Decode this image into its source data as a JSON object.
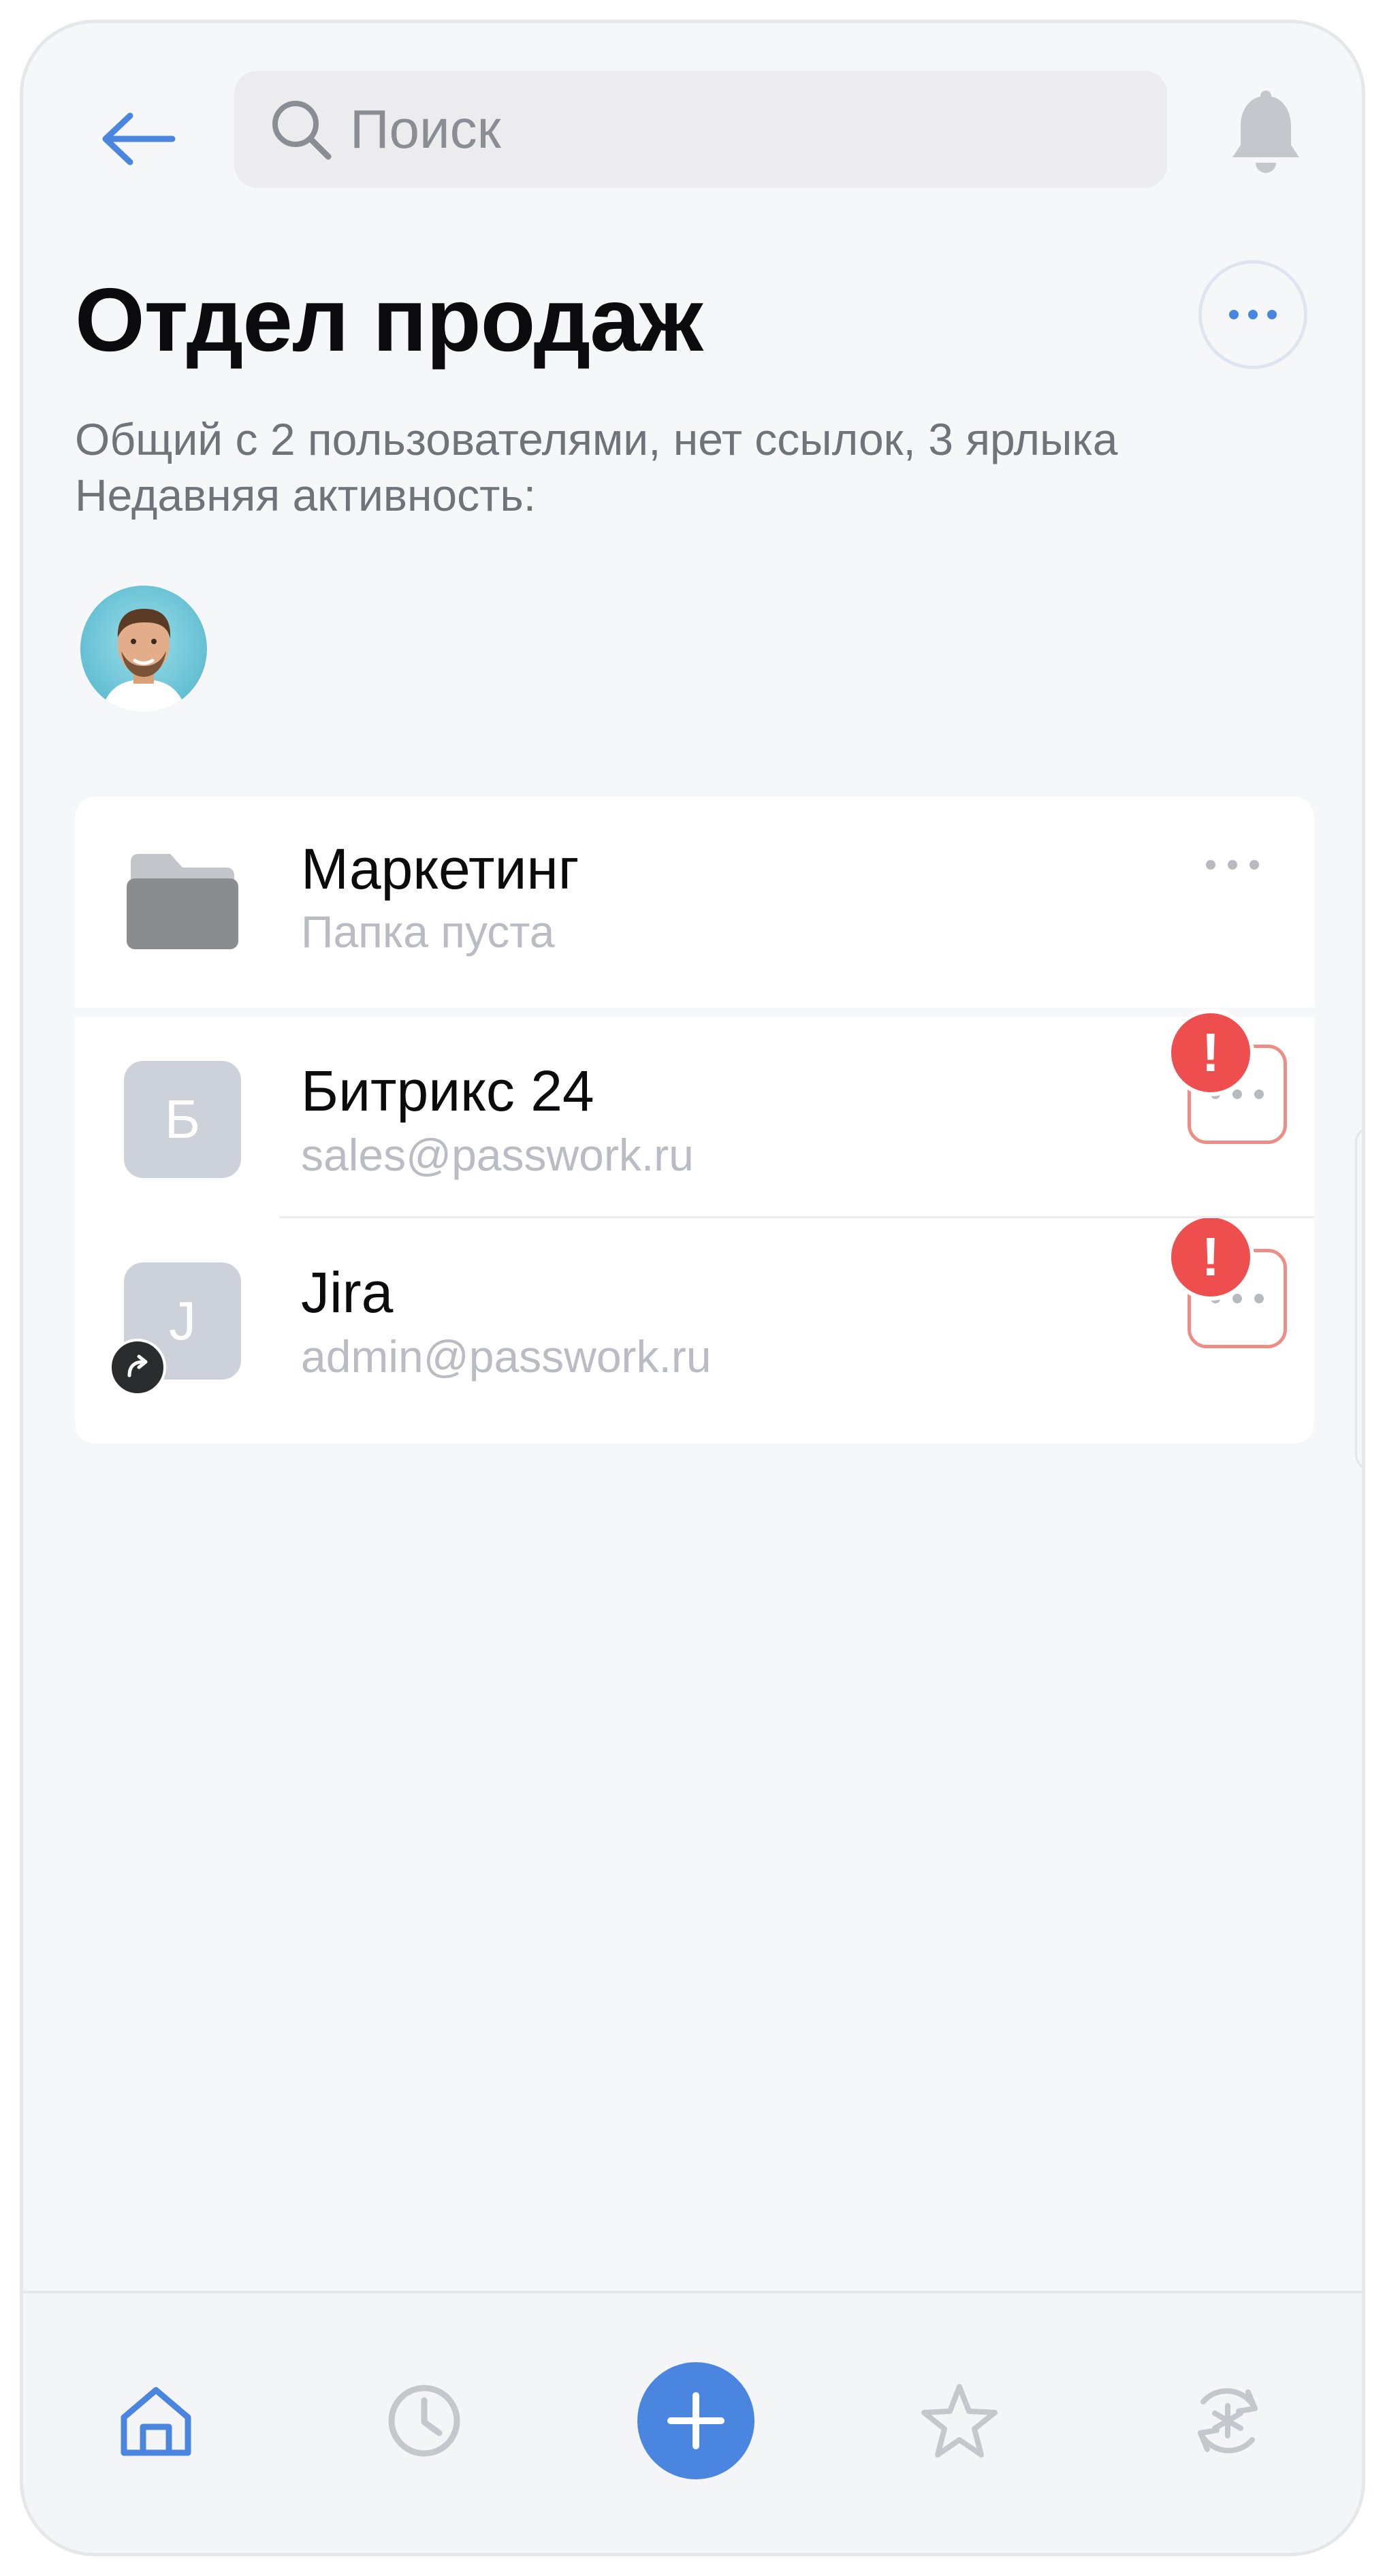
{
  "header": {
    "search_placeholder": "Поиск",
    "back_icon": "arrow-left-icon",
    "bell_icon": "bell-icon"
  },
  "vault": {
    "title": "Отдел продаж",
    "subtitle_line1": "Общий с 2 пользователями, нет ссылок, 3 ярлыка",
    "subtitle_line2": "Недавняя активность:"
  },
  "items": [
    {
      "type": "folder",
      "title": "Маркетинг",
      "subtitle": "Папка пуста",
      "icon": "folder-icon"
    },
    {
      "type": "password",
      "letter": "Б",
      "title": "Битрикс 24",
      "subtitle": "sales@passwork.ru",
      "alert": "!"
    },
    {
      "type": "password",
      "letter": "J",
      "title": "Jira",
      "subtitle": "admin@passwork.ru",
      "alert": "!",
      "shortcut": true
    }
  ],
  "bottom_nav": {
    "items": [
      "home-icon",
      "clock-icon",
      "plus-icon",
      "star-icon",
      "password-generator-icon"
    ],
    "active": "home-icon"
  },
  "colors": {
    "accent": "#4a86e0",
    "alert": "#ef4e4e",
    "alert_border": "#ee8d88",
    "tile": "#cdd2da"
  }
}
